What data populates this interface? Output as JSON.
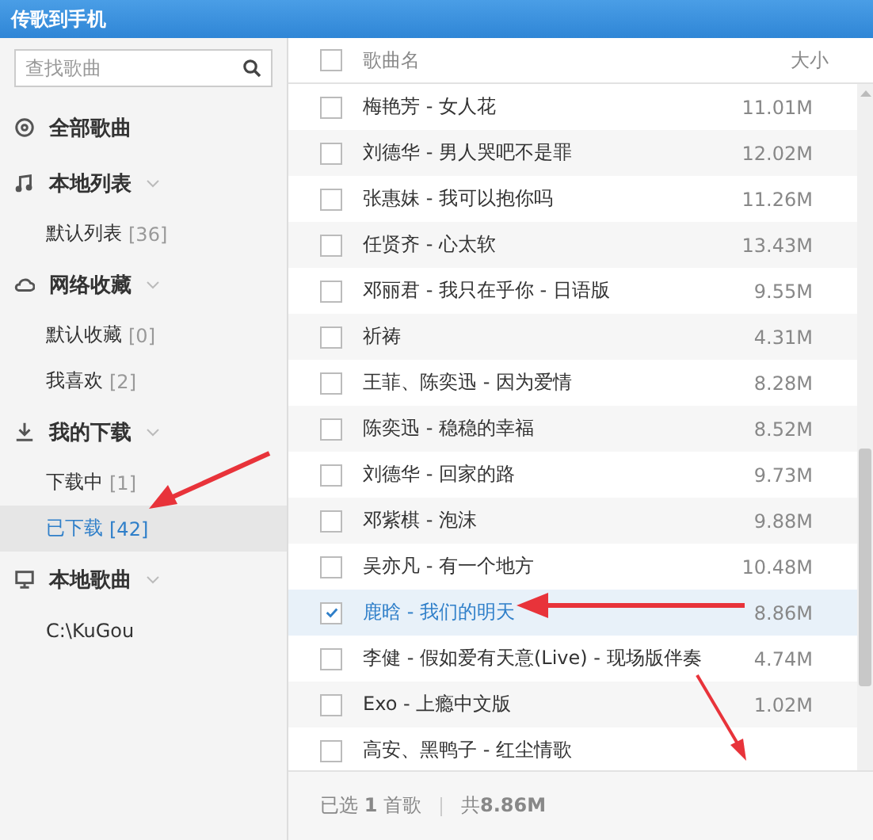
{
  "window": {
    "title": "传歌到手机"
  },
  "search": {
    "placeholder": "查找歌曲"
  },
  "sidebar": [
    {
      "kind": "all",
      "label": "全部歌曲"
    },
    {
      "kind": "local",
      "label": "本地列表",
      "children": [
        {
          "label": "默认列表",
          "count": "[36]",
          "selected": false
        }
      ]
    },
    {
      "kind": "cloud",
      "label": "网络收藏",
      "children": [
        {
          "label": "默认收藏",
          "count": "[0]",
          "selected": false
        },
        {
          "label": "我喜欢",
          "count": "[2]",
          "selected": false
        }
      ]
    },
    {
      "kind": "download",
      "label": "我的下载",
      "children": [
        {
          "label": "下载中",
          "count": "[1]",
          "selected": false
        },
        {
          "label": "已下载",
          "count": "[42]",
          "selected": true
        }
      ]
    },
    {
      "kind": "computer",
      "label": "本地歌曲",
      "children": [
        {
          "label": "C:\\KuGou",
          "selected": false
        }
      ]
    }
  ],
  "table": {
    "header_checked": false,
    "columns": [
      "歌曲名",
      "大小"
    ],
    "rows": [
      {
        "title": "梅艳芳 - 女人花",
        "size": "11.01M",
        "checked": false
      },
      {
        "title": "刘德华 - 男人哭吧不是罪",
        "size": "12.02M",
        "checked": false
      },
      {
        "title": "张惠妹 - 我可以抱你吗",
        "size": "11.26M",
        "checked": false
      },
      {
        "title": "任贤齐 - 心太软",
        "size": "13.43M",
        "checked": false
      },
      {
        "title": "邓丽君 - 我只在乎你 - 日语版",
        "size": "9.55M",
        "checked": false
      },
      {
        "title": "祈祷",
        "size": "4.31M",
        "checked": false
      },
      {
        "title": "王菲、陈奕迅 - 因为爱情",
        "size": "8.28M",
        "checked": false
      },
      {
        "title": "陈奕迅 - 稳稳的幸福",
        "size": "8.52M",
        "checked": false
      },
      {
        "title": "刘德华 - 回家的路",
        "size": "9.73M",
        "checked": false
      },
      {
        "title": "邓紫棋 - 泡沫",
        "size": "9.88M",
        "checked": false
      },
      {
        "title": "吴亦凡 - 有一个地方",
        "size": "10.48M",
        "checked": false
      },
      {
        "title": "鹿晗 - 我们的明天",
        "size": "8.86M",
        "checked": true
      },
      {
        "title": "李健 - 假如爱有天意(Live) - 现场版伴奏",
        "size": "4.74M",
        "checked": false
      },
      {
        "title": "Exo - 上瘾中文版",
        "size": "1.02M",
        "checked": false
      },
      {
        "title": "高安、黑鸭子 - 红尘情歌",
        "checked": false
      }
    ]
  },
  "status_bar": {
    "selected": "已选 **1** 首歌",
    "total": "共**8.86M**"
  }
}
